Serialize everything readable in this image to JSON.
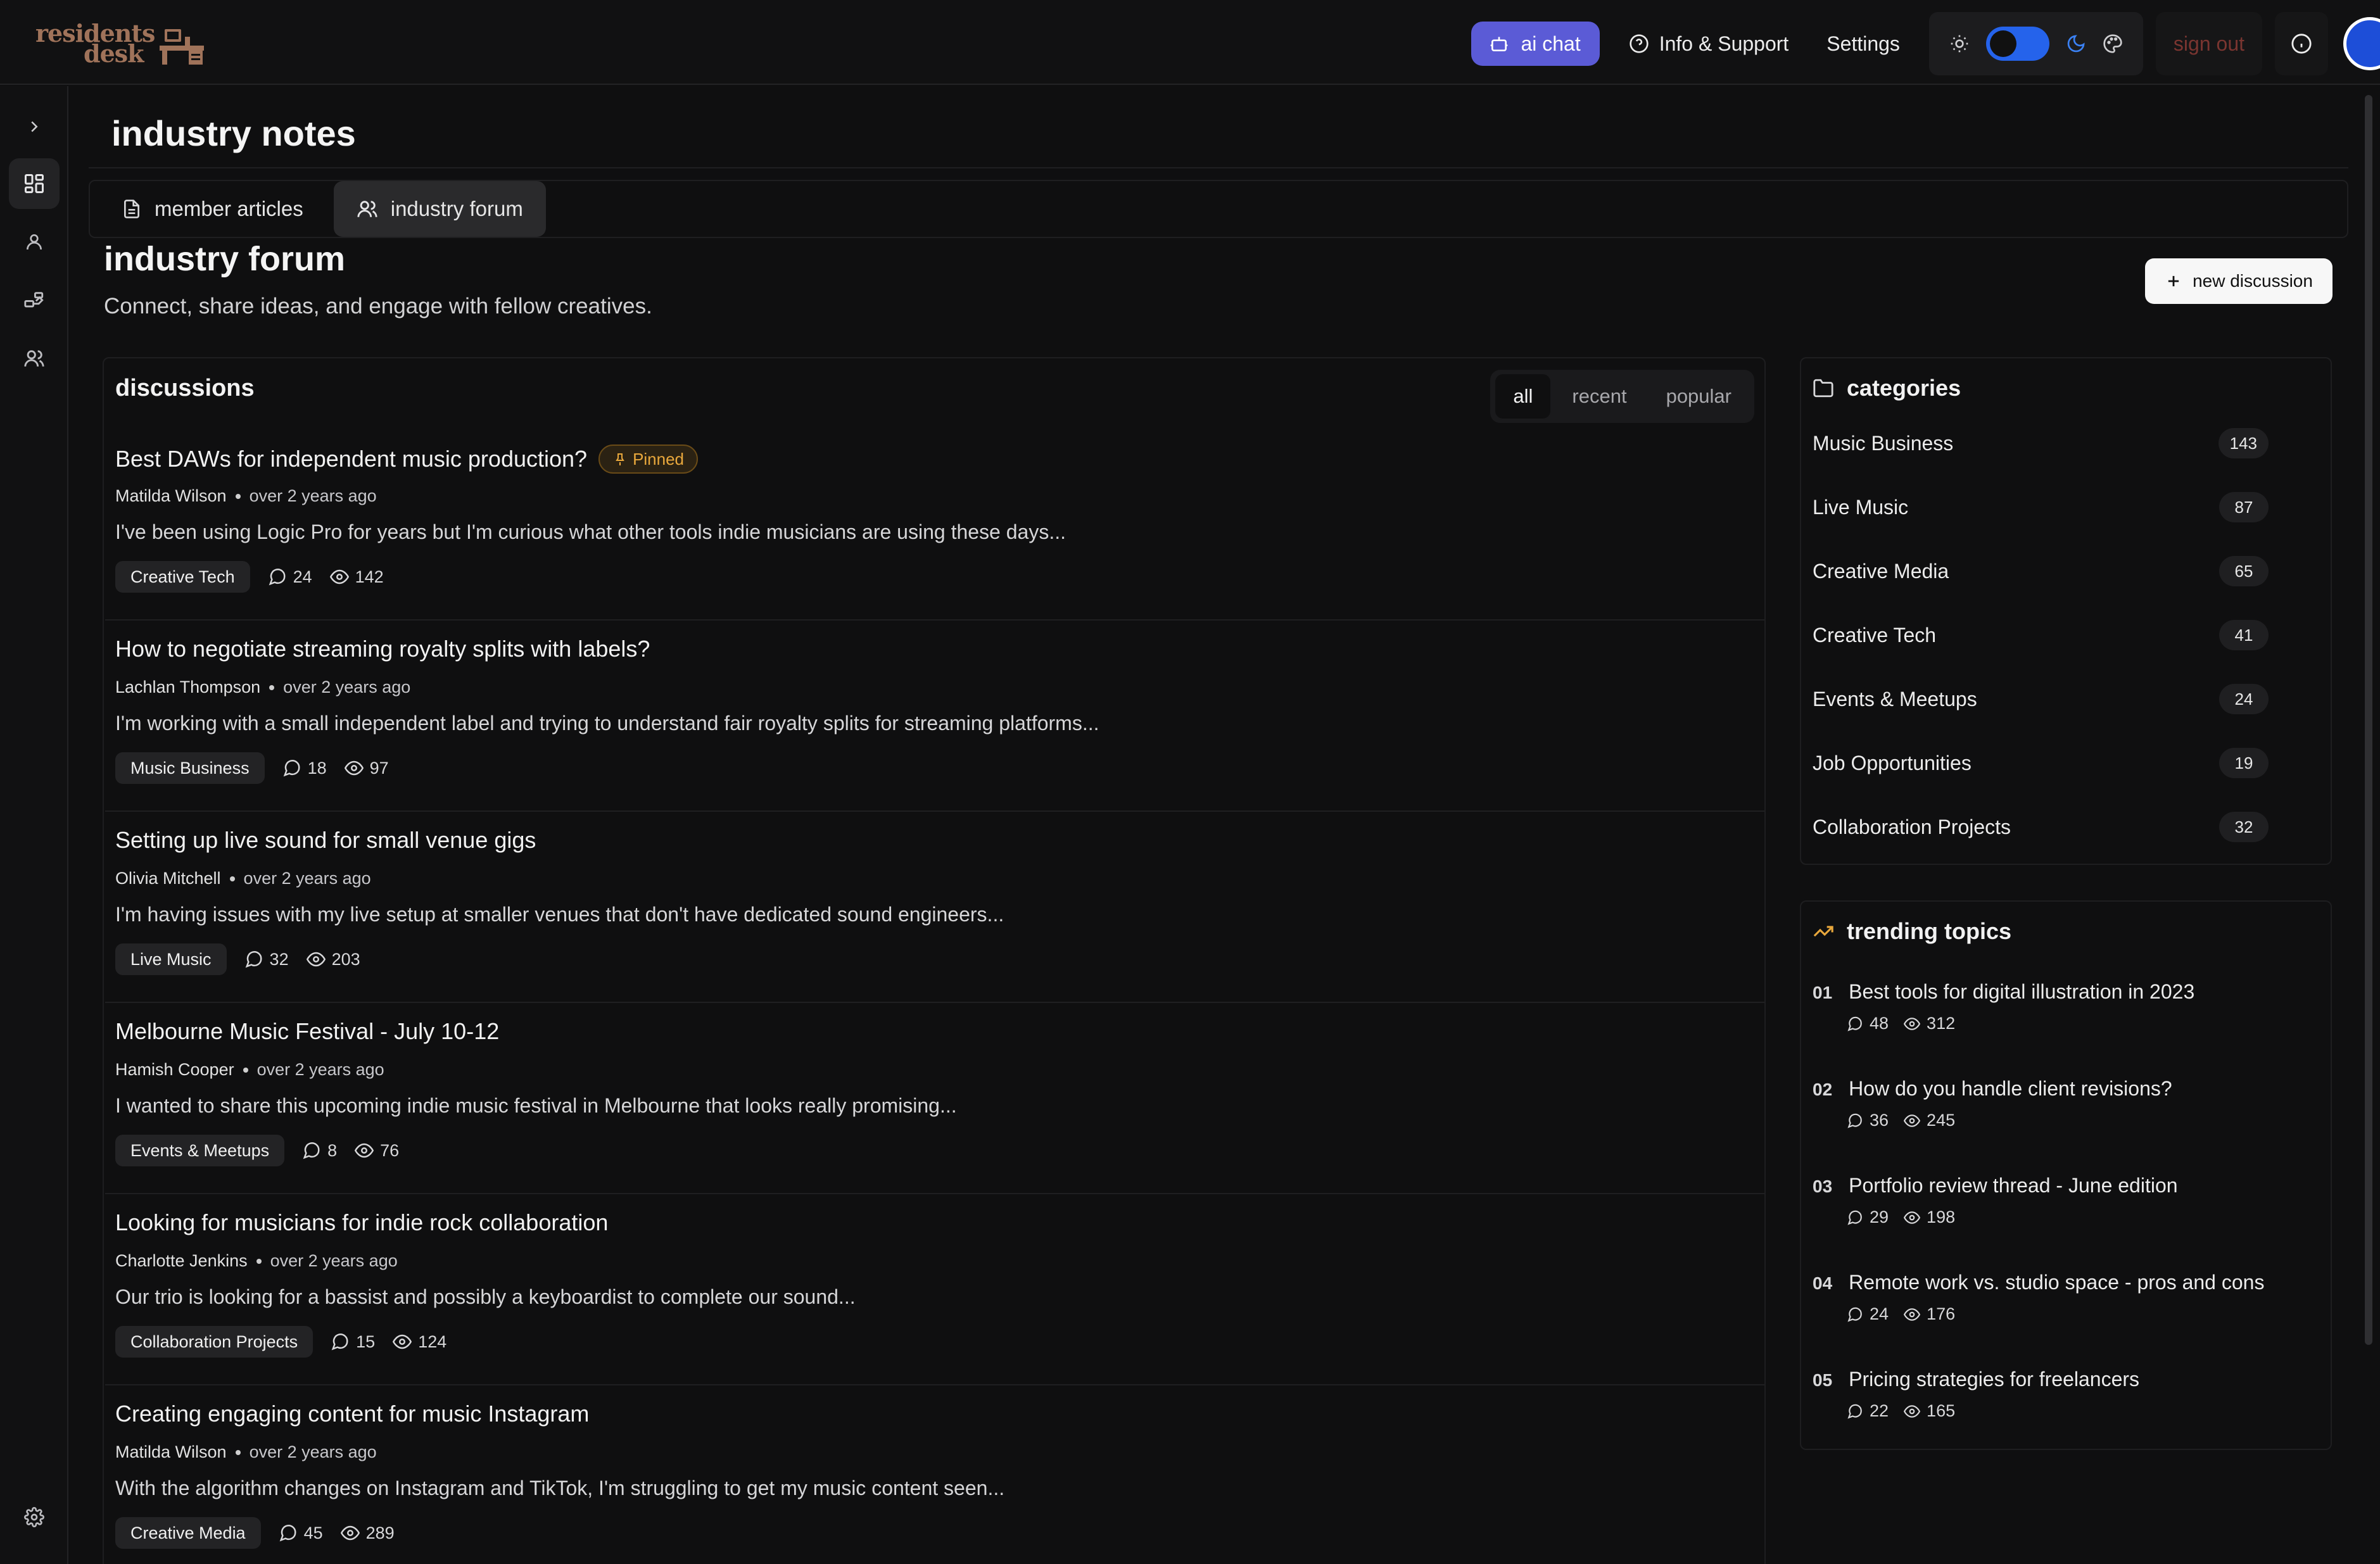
{
  "brand": {
    "line1": "residents",
    "line2": "desk"
  },
  "topbar": {
    "ai_chat": "ai chat",
    "info_support": "Info & Support",
    "settings": "Settings",
    "sign_out": "sign out"
  },
  "page": {
    "title": "industry notes"
  },
  "tabs": [
    {
      "label": "member articles"
    },
    {
      "label": "industry forum"
    }
  ],
  "forum": {
    "title": "industry forum",
    "subtitle": "Connect, share ideas, and engage with fellow creatives.",
    "new_discussion": "new discussion"
  },
  "discussions": {
    "heading": "discussions",
    "filters": [
      "all",
      "recent",
      "popular"
    ],
    "pinned_label": "Pinned",
    "threads": [
      {
        "title": "Best DAWs for independent music production?",
        "author": "Matilda Wilson",
        "time": "over 2 years ago",
        "excerpt": "I've been using Logic Pro for years but I'm curious what other tools indie musicians are using these days...",
        "tag": "Creative Tech",
        "comments": "24",
        "views": "142"
      },
      {
        "title": "How to negotiate streaming royalty splits with labels?",
        "author": "Lachlan Thompson",
        "time": "over 2 years ago",
        "excerpt": "I'm working with a small independent label and trying to understand fair royalty splits for streaming platforms...",
        "tag": "Music Business",
        "comments": "18",
        "views": "97"
      },
      {
        "title": "Setting up live sound for small venue gigs",
        "author": "Olivia Mitchell",
        "time": "over 2 years ago",
        "excerpt": "I'm having issues with my live setup at smaller venues that don't have dedicated sound engineers...",
        "tag": "Live Music",
        "comments": "32",
        "views": "203"
      },
      {
        "title": "Melbourne Music Festival - July 10-12",
        "author": "Hamish Cooper",
        "time": "over 2 years ago",
        "excerpt": "I wanted to share this upcoming indie music festival in Melbourne that looks really promising...",
        "tag": "Events & Meetups",
        "comments": "8",
        "views": "76"
      },
      {
        "title": "Looking for musicians for indie rock collaboration",
        "author": "Charlotte Jenkins",
        "time": "over 2 years ago",
        "excerpt": "Our trio is looking for a bassist and possibly a keyboardist to complete our sound...",
        "tag": "Collaboration Projects",
        "comments": "15",
        "views": "124"
      },
      {
        "title": "Creating engaging content for music Instagram",
        "author": "Matilda Wilson",
        "time": "over 2 years ago",
        "excerpt": "With the algorithm changes on Instagram and TikTok, I'm struggling to get my music content seen...",
        "tag": "Creative Media",
        "comments": "45",
        "views": "289"
      }
    ]
  },
  "categories": {
    "heading": "categories",
    "items": [
      {
        "name": "Music Business",
        "count": "143"
      },
      {
        "name": "Live Music",
        "count": "87"
      },
      {
        "name": "Creative Media",
        "count": "65"
      },
      {
        "name": "Creative Tech",
        "count": "41"
      },
      {
        "name": "Events & Meetups",
        "count": "24"
      },
      {
        "name": "Job Opportunities",
        "count": "19"
      },
      {
        "name": "Collaboration Projects",
        "count": "32"
      }
    ]
  },
  "trending": {
    "heading": "trending topics",
    "items": [
      {
        "rank": "01",
        "title": "Best tools for digital illustration in 2023",
        "comments": "48",
        "views": "312"
      },
      {
        "rank": "02",
        "title": "How do you handle client revisions?",
        "comments": "36",
        "views": "245"
      },
      {
        "rank": "03",
        "title": "Portfolio review thread - June edition",
        "comments": "29",
        "views": "198"
      },
      {
        "rank": "04",
        "title": "Remote work vs. studio space - pros and cons",
        "comments": "24",
        "views": "176"
      },
      {
        "rank": "05",
        "title": "Pricing strategies for freelancers",
        "comments": "22",
        "views": "165"
      }
    ]
  },
  "colors": {
    "accent": "#5b5bd6",
    "toggle": "#2563eb",
    "pinned": "#e9a83c",
    "trending_icon": "#e9a83c",
    "brand": "#a0735a"
  },
  "icons": {
    "rail": [
      "chevron-right-icon",
      "dashboard-icon",
      "user-icon",
      "tools-icon",
      "users-icon",
      "settings-gear-icon"
    ],
    "topbar": [
      "bot-icon",
      "help-circle-icon",
      "sun-icon",
      "moon-icon",
      "palette-icon",
      "info-icon",
      "accessibility-icon"
    ]
  }
}
